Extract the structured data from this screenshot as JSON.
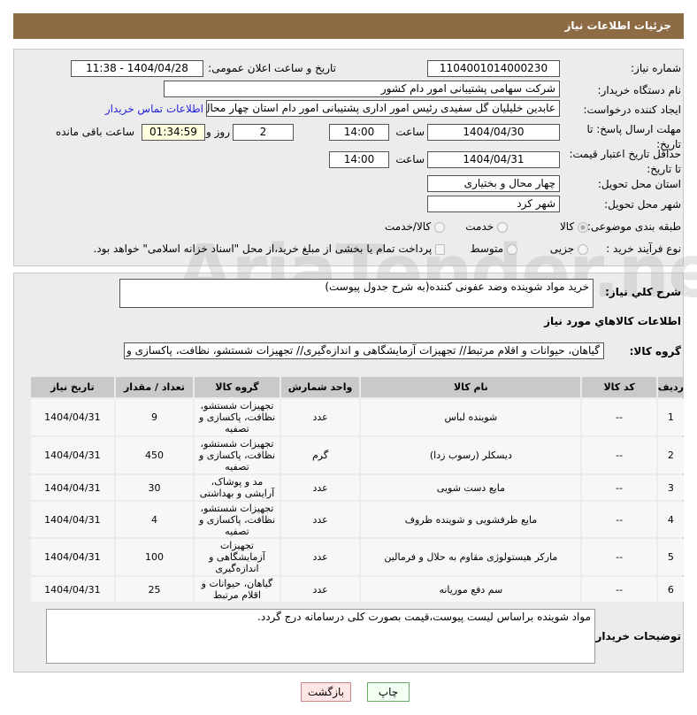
{
  "header": {
    "title": "جزئیات اطلاعات نیاز"
  },
  "form": {
    "need_number_label": "شماره نیاز:",
    "need_number": "1104001014000230",
    "announce_label": "تاریخ و ساعت اعلان عمومی:",
    "announce_value": "1404/04/28 - 11:38",
    "buyer_label": "نام دستگاه خریدار:",
    "buyer_value": "شرکت سهامی پشتیبانی امور دام کشور",
    "creator_label": "ایجاد کننده درخواست:",
    "creator_value": "عابدین خلیلیان گل سفیدی رئیس امور اداری پشتیبانی امور دام استان چهار محال",
    "contact_link": "اطلاعات تماس خریدار",
    "deadline_label": "مهلت ارسال پاسخ: تا تاریخ:",
    "deadline_date": "1404/04/30",
    "time_label": "ساعت",
    "deadline_time": "14:00",
    "days": "2",
    "days_label": "روز و",
    "remaining": "01:34:59",
    "remaining_label": "ساعت باقی مانده",
    "validity_label": "حداقل تاریخ اعتبار قیمت: تا تاریخ:",
    "validity_date": "1404/04/31",
    "validity_time": "14:00",
    "province_label": "استان محل تحویل:",
    "province_value": "چهار محال و بختیاری",
    "city_label": "شهر محل تحویل:",
    "city_value": "شهر کرد",
    "category_label": "طبقه بندی موضوعی:",
    "category_options": [
      "کالا",
      "خدمت",
      "کالا/خدمت"
    ],
    "process_label": "نوع فرآیند خرید :",
    "process_options": [
      "جزیی",
      "متوسط"
    ],
    "payment_note": "پرداخت تمام یا بخشی از مبلغ خرید،از محل \"اسناد خزانه اسلامی\" خواهد بود."
  },
  "details": {
    "desc_label": "شرح کلي نياز:",
    "desc_value": "خرید مواد شوینده وضد عفونی کننده(به شرح جدول پیوست)",
    "goods_heading": "اطلاعات کالاهاي مورد نياز",
    "group_label": "گروه کالا:",
    "group_value": "گیاهان، حیوانات و اقلام مرتبط// تجهیزات آزمایشگاهی و اندازه‌گیری// تجهیزات شستشو، نظافت، پاکسازی و تصفیه",
    "columns": [
      "ردیف",
      "کد کالا",
      "نام کالا",
      "واحد شمارش",
      "گروه کالا",
      "تعداد / مقدار",
      "تاریخ نیاز"
    ],
    "rows": [
      {
        "n": "1",
        "code": "--",
        "name": "شوینده لباس",
        "unit": "عدد",
        "group": "تجهیزات شستشو، نظافت، پاکسازی و تصفیه",
        "qty": "9",
        "date": "1404/04/31"
      },
      {
        "n": "2",
        "code": "--",
        "name": "دیسکلر (رسوب زدا)",
        "unit": "گرم",
        "group": "تجهیزات شستشو، نظافت، پاکسازی و تصفیه",
        "qty": "450",
        "date": "1404/04/31"
      },
      {
        "n": "3",
        "code": "--",
        "name": "مایع دست شویی",
        "unit": "عدد",
        "group": "مد و پوشاک، آرایشی و بهداشتی",
        "qty": "30",
        "date": "1404/04/31"
      },
      {
        "n": "4",
        "code": "--",
        "name": "مایع ظرفشویی و شوینده ظروف",
        "unit": "عدد",
        "group": "تجهیزات شستشو، نظافت، پاکسازی و تصفیه",
        "qty": "4",
        "date": "1404/04/31"
      },
      {
        "n": "5",
        "code": "--",
        "name": "مارکر هیستولوژی مقاوم به حلال و فرمالین",
        "unit": "عدد",
        "group": "تجهیزات آزمایشگاهی و اندازه‌گیری",
        "qty": "100",
        "date": "1404/04/31"
      },
      {
        "n": "6",
        "code": "--",
        "name": "سم دفع موریانه",
        "unit": "عدد",
        "group": "گیاهان، حیوانات و اقلام مرتبط",
        "qty": "25",
        "date": "1404/04/31"
      }
    ],
    "notes_label": "توضیحات خریدار:",
    "notes_value": "مواد شوینده براساس لیست پیوست،قیمت بصورت کلی درسامانه درج گردد."
  },
  "buttons": {
    "print": "چاپ",
    "back": "بازگشت"
  },
  "watermark": "AriaTender.net"
}
